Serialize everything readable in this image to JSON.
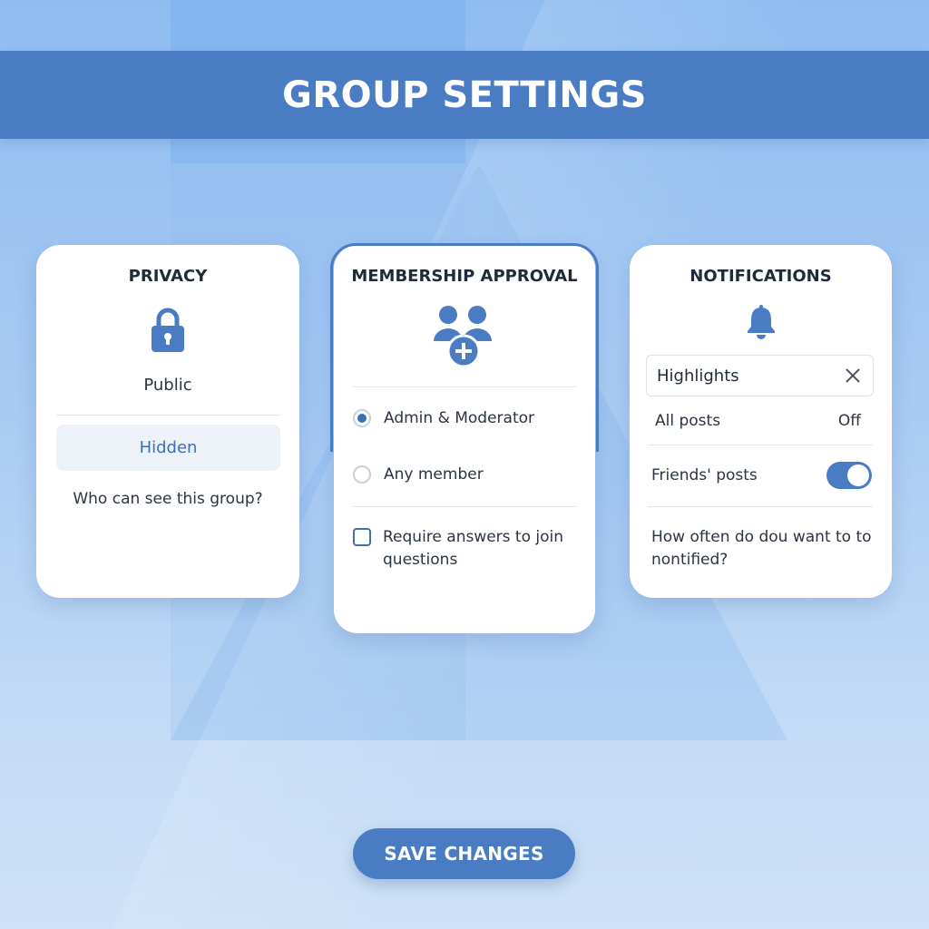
{
  "header": {
    "title": "GROUP SETTINGS"
  },
  "privacy": {
    "title": "PRIVACY",
    "icon": "lock-icon",
    "options": [
      "Public",
      "Hidden"
    ],
    "selected": "Hidden",
    "question": "Who can see this group?"
  },
  "membership": {
    "title": "MEMBERSHIP APPROVAL",
    "icon": "people-add-icon",
    "radio_options": [
      {
        "label": "Admin & Moderator",
        "checked": true
      },
      {
        "label": "Any member",
        "checked": false
      }
    ],
    "checkbox": {
      "label": "Require answers to join questions",
      "checked": false
    }
  },
  "notifications": {
    "title": "NOTIFICATIONS",
    "icon": "bell-icon",
    "input_value": "Highlights",
    "all_posts": {
      "label": "All posts",
      "value": "Off"
    },
    "friends_posts": {
      "label": "Friends' posts",
      "enabled": true
    },
    "question": "How often do dou want to to nontified?"
  },
  "footer": {
    "save_label": "SAVE CHANGES"
  },
  "colors": {
    "accent": "#4a7cc4",
    "link": "#3d6fb8",
    "text": "#2a3442"
  }
}
